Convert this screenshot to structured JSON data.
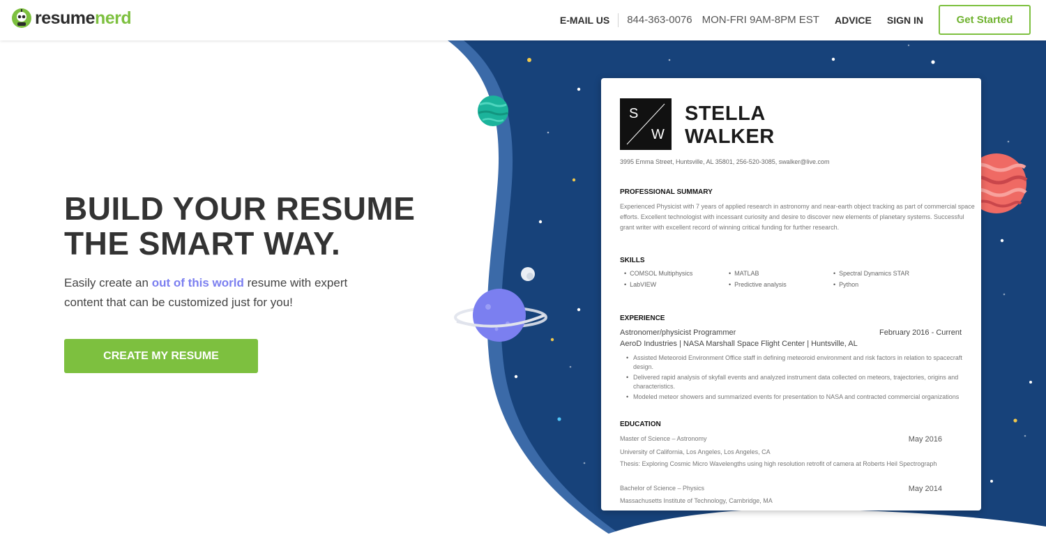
{
  "header": {
    "logo": {
      "part1": "resume",
      "part2": "nerd"
    },
    "nav": {
      "email_label": "E-MAIL US",
      "phone": "844-363-0076",
      "hours": "MON-FRI 9AM-8PM EST",
      "advice_label": "ADVICE",
      "signin_label": "SIGN IN",
      "cta_label": "Get Started"
    }
  },
  "hero": {
    "title_line1": "BUILD YOUR RESUME",
    "title_line2": "THE SMART WAY.",
    "sub_before": "Easily create an ",
    "sub_accent": "out of this world",
    "sub_after": " resume with expert content that can be customized just for you!",
    "cta_label": "CREATE MY RESUME"
  },
  "resume": {
    "monogram": {
      "first": "S",
      "last": "W"
    },
    "first_name": "STELLA",
    "last_name": "WALKER",
    "contact": "3995 Emma Street, Huntsville, AL 35801, 256-520-3085, swalker@live.com",
    "summary_heading": "PROFESSIONAL SUMMARY",
    "summary": "Experienced Physicist with 7 years of applied research in astronomy and near-earth object tracking as part of commercial space efforts. Excellent technologist with incessant curiosity and desire to discover new elements of planetary systems. Successful grant writer with excellent record of winning critical funding for further research.",
    "skills_heading": "SKILLS",
    "skills": [
      "COMSOL Multiphysics",
      "MATLAB",
      "Spectral Dynamics STAR",
      "LabVIEW",
      "Predictive analysis",
      "Python"
    ],
    "experience_heading": "EXPERIENCE",
    "job_title": "Astronomer/physicist Programmer",
    "job_dates": "February 2016 - Current",
    "job_company": "AeroD Industries | NASA Marshall Space Flight Center | Huntsville, AL",
    "job_bullets": [
      "Assisted Meteoroid Environment Office staff in defining meteoroid environment and risk factors in relation to spacecraft design.",
      "Delivered rapid analysis of skyfall events and analyzed instrument data collected on meteors, trajectories, origins and characteristics.",
      "Modeled meteor showers and summarized events for presentation to NASA and contracted commercial organizations"
    ],
    "education_heading": "EDUCATION",
    "edu1_degree": "Master of Science – Astronomy",
    "edu1_date": "May 2016",
    "edu1_school": "University of California, Los Angeles, Los Angeles, CA",
    "edu1_thesis": "Thesis: Exploring Cosmic Micro Wavelengths using high resolution retrofit of camera at Roberts Heil Spectrograph",
    "edu2_degree": "Bachelor of Science – Physics",
    "edu2_date": "May 2014",
    "edu2_school": "Massachusetts Institute of Technology, Cambridge, MA"
  },
  "colors": {
    "brand_green": "#7dc03f",
    "space_blue": "#17427a",
    "accent_purple": "#7b7ff0"
  }
}
